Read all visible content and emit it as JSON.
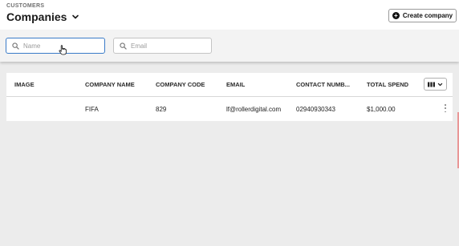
{
  "header": {
    "section": "CUSTOMERS",
    "title": "Companies",
    "create_label": "Create company"
  },
  "filters": {
    "name_placeholder": "Name",
    "email_placeholder": "Email"
  },
  "table": {
    "columns": [
      "IMAGE",
      "COMPANY NAME",
      "COMPANY CODE",
      "EMAIL",
      "CONTACT NUMB...",
      "TOTAL SPEND"
    ],
    "rows": [
      {
        "image": "",
        "company_name": "FIFA",
        "company_code": "829",
        "email": "lf@rollerdigital.com",
        "contact_number": "02940930343",
        "total_spend": "$1,000.00"
      }
    ]
  },
  "icons": {
    "title_dropdown": "chevron-down-icon",
    "create": "plus-circle-icon",
    "search": "search-icon",
    "columns": "columns-icon",
    "row_menu": "kebab-menu-icon",
    "cursor": "hand-pointer-icon"
  },
  "colors": {
    "focus_border": "#3a7bc8",
    "background": "#ececec",
    "surface": "#ffffff"
  }
}
